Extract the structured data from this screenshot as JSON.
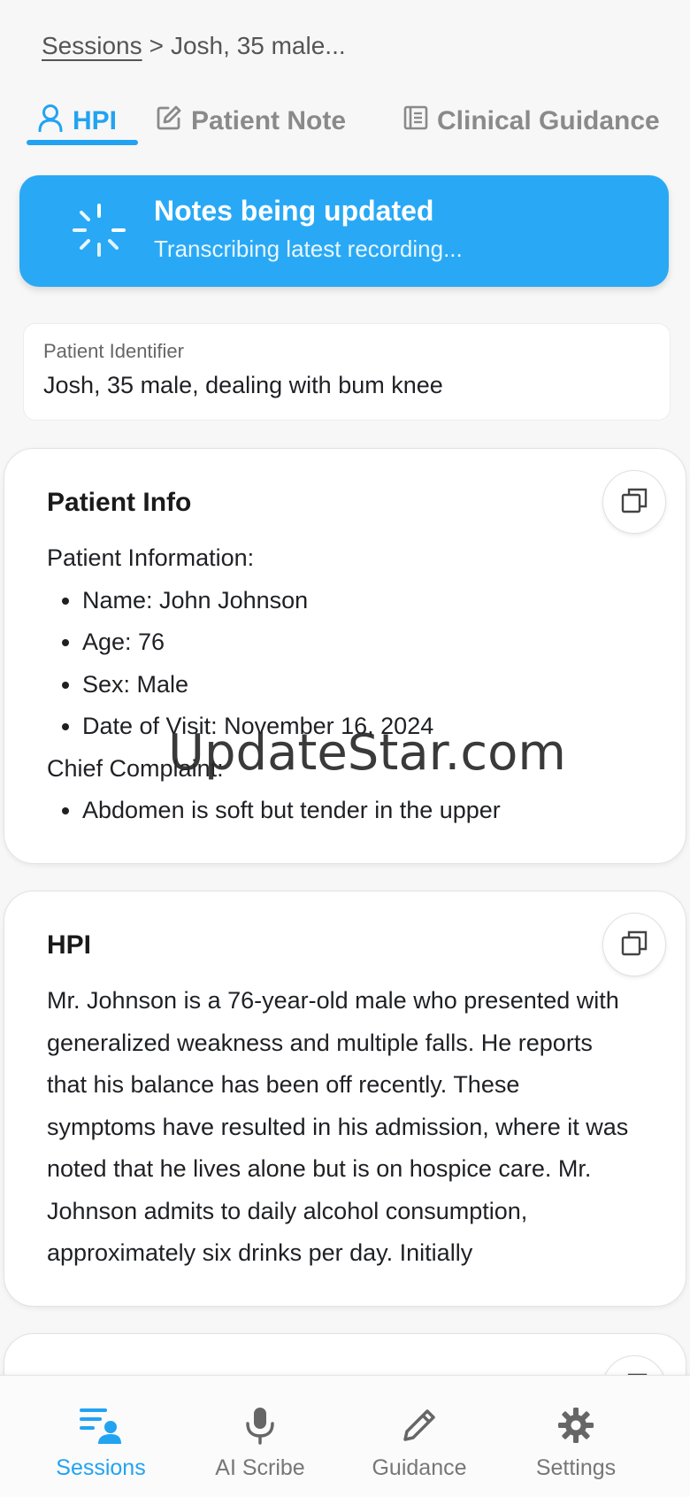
{
  "breadcrumb": {
    "root": "Sessions",
    "separator": ">",
    "current": "Josh, 35 male..."
  },
  "tabs": [
    {
      "label": "HPI",
      "icon": "user-icon",
      "active": true
    },
    {
      "label": "Patient Note",
      "icon": "edit-note-icon",
      "active": false
    },
    {
      "label": "Clinical Guidance",
      "icon": "document-list-icon",
      "active": false
    }
  ],
  "banner": {
    "title": "Notes being updated",
    "subtitle": "Transcribing latest recording...",
    "icon": "loading-spinner-icon",
    "color": "#29a9f5"
  },
  "identifier": {
    "label": "Patient Identifier",
    "value": "Josh, 35 male, dealing with bum knee"
  },
  "patient_info": {
    "title": "Patient Info",
    "heading": "Patient Information:",
    "items": [
      "Name: John Johnson",
      "Age: 76",
      "Sex: Male",
      "Date of Visit: November 16, 2024"
    ],
    "complaint_heading": "Chief Complaint:",
    "complaint_items": [
      "Abdomen is soft but tender in the upper"
    ]
  },
  "hpi": {
    "title": "HPI",
    "text": "Mr. Johnson is a 76-year-old male who presented with generalized weakness and multiple falls. He reports that his balance has been off recently. These symptoms have resulted in his admission, where it was noted that he lives alone but is on hospice care. Mr. Johnson admits to daily alcohol consumption, approximately six drinks per day. Initially"
  },
  "watermark": "UpdateStar.com",
  "bottom_nav": [
    {
      "label": "Sessions",
      "icon": "sessions-list-icon",
      "active": true
    },
    {
      "label": "AI Scribe",
      "icon": "microphone-icon",
      "active": false
    },
    {
      "label": "Guidance",
      "icon": "pencil-icon",
      "active": false
    },
    {
      "label": "Settings",
      "icon": "gear-icon",
      "active": false
    }
  ],
  "colors": {
    "accent": "#22a3f2",
    "inactive": "#8a8a8a",
    "background": "#f7f7f7"
  }
}
